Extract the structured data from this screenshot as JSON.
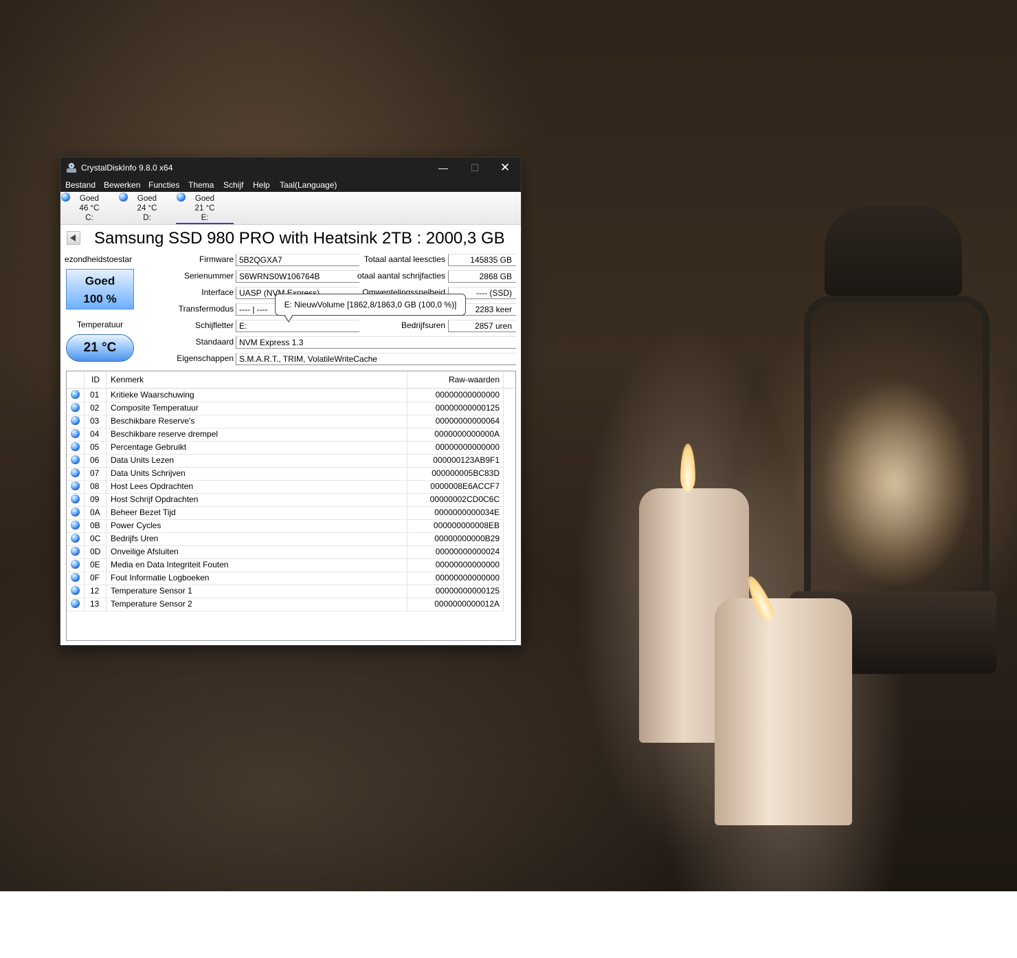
{
  "window": {
    "title": "CrystalDiskInfo 9.8.0 x64",
    "controls": {
      "minimize": "—",
      "maximize": "☐",
      "close": "✕"
    }
  },
  "menu": [
    "Bestand",
    "Bewerken",
    "Functies",
    "Thema",
    "Schijf",
    "Help",
    "Taal(Language)"
  ],
  "drives": [
    {
      "status": "Goed",
      "temp": "46 °C",
      "letter": "C:"
    },
    {
      "status": "Goed",
      "temp": "24 °C",
      "letter": "D:"
    },
    {
      "status": "Goed",
      "temp": "21 °C",
      "letter": "E:"
    }
  ],
  "disk": {
    "model": "Samsung SSD 980 PRO with Heatsink 2TB : 2000,3 GB",
    "health_label": "ezondheidstoestar",
    "health_status": "Goed",
    "health_percent": "100 %",
    "temperature_label": "Temperatuur",
    "temperature": "21 °C"
  },
  "fields": {
    "firmware_label": "Firmware",
    "firmware": "5B2QGXA7",
    "serial_label": "Serienummer",
    "serial": "S6WRNS0W106764B",
    "interface_label": "Interface",
    "interface": "UASP (NVM Express)",
    "transfer_label": "Transfermodus",
    "transfer": "---- | ----",
    "letter_label": "Schijfletter",
    "letter": "E:",
    "standard_label": "Standaard",
    "standard": "NVM Express 1.3",
    "features_label": "Eigenschappen",
    "features": "S.M.A.R.T., TRIM, VolatileWriteCache",
    "reads_label": "Totaal aantal leescties",
    "reads": "145835 GB",
    "writes_label": "otaal aantal schrijfacties",
    "writes": "2868 GB",
    "rotation_label": "Omwentelingssnelheid",
    "rotation": "---- (SSD)",
    "power_count": "2283 keer",
    "hours_label": "Bedrijfsuren",
    "hours": "2857 uren"
  },
  "tooltip": "E: NieuwVolume [1862,8/1863,0 GB (100,0 %)]",
  "smart": {
    "headers": {
      "id": "ID",
      "name": "Kenmerk",
      "raw": "Raw-waarden"
    },
    "rows": [
      {
        "id": "01",
        "name": "Kritieke Waarschuwing",
        "raw": "00000000000000"
      },
      {
        "id": "02",
        "name": "Composite Temperatuur",
        "raw": "00000000000125"
      },
      {
        "id": "03",
        "name": "Beschikbare Reserve's",
        "raw": "00000000000064"
      },
      {
        "id": "04",
        "name": "Beschikbare reserve drempel",
        "raw": "0000000000000A"
      },
      {
        "id": "05",
        "name": "Percentage Gebruikt",
        "raw": "00000000000000"
      },
      {
        "id": "06",
        "name": "Data Units Lezen",
        "raw": "000000123AB9F1"
      },
      {
        "id": "07",
        "name": "Data Units Schrijven",
        "raw": "000000005BC83D"
      },
      {
        "id": "08",
        "name": "Host Lees Opdrachten",
        "raw": "0000008E6ACCF7"
      },
      {
        "id": "09",
        "name": "Host Schrijf Opdrachten",
        "raw": "00000002CD0C6C"
      },
      {
        "id": "0A",
        "name": "Beheer Bezet Tijd",
        "raw": "0000000000034E"
      },
      {
        "id": "0B",
        "name": "Power Cycles",
        "raw": "000000000008EB"
      },
      {
        "id": "0C",
        "name": "Bedrijfs Uren",
        "raw": "00000000000B29"
      },
      {
        "id": "0D",
        "name": "Onveilige Afsluiten",
        "raw": "00000000000024"
      },
      {
        "id": "0E",
        "name": "Media en Data Integriteit Fouten",
        "raw": "00000000000000"
      },
      {
        "id": "0F",
        "name": "Fout Informatie Logboeken",
        "raw": "00000000000000"
      },
      {
        "id": "12",
        "name": "Temperature Sensor 1",
        "raw": "00000000000125"
      },
      {
        "id": "13",
        "name": "Temperature Sensor 2",
        "raw": "0000000000012A"
      }
    ]
  }
}
